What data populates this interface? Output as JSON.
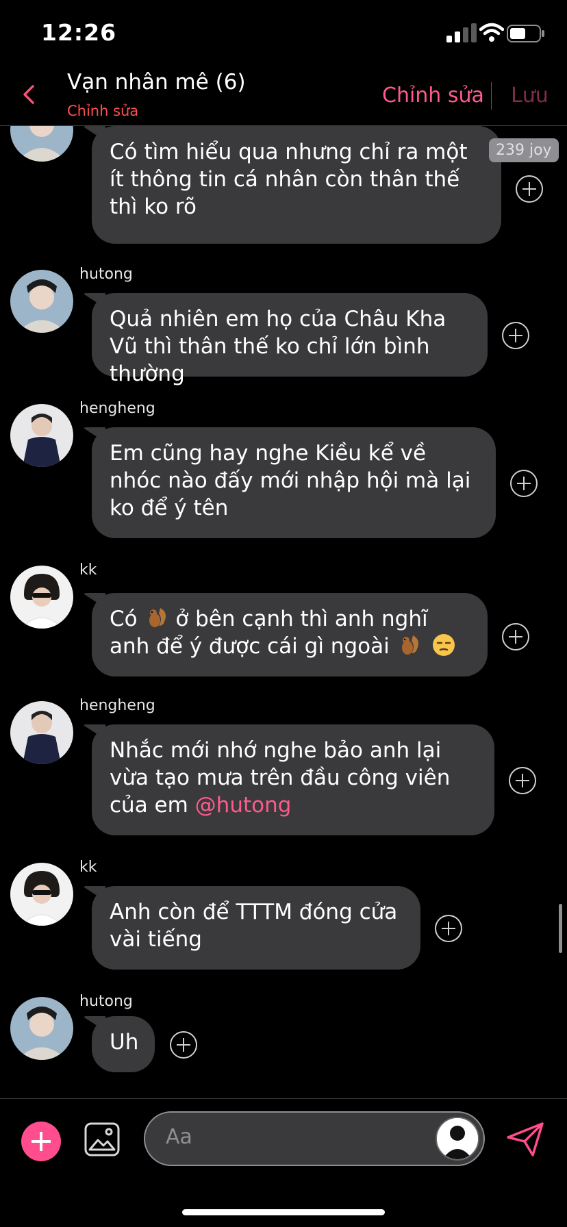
{
  "status_bar": {
    "time": "12:26"
  },
  "header": {
    "title": "Vạn nhân mê (6)",
    "subtitle": "Chỉnh sửa",
    "edit_label": "Chỉnh sửa",
    "save_label": "Lưu"
  },
  "joy_badge": "239 joy",
  "messages": [
    {
      "sender": "",
      "text": "Có tìm hiểu qua nhưng chỉ ra một ít thông tin cá nhân còn thân thế thì ko rõ"
    },
    {
      "sender": "hutong",
      "text": "Quả nhiên em họ của Châu Kha Vũ thì thân thế ko chỉ lớn bình thường"
    },
    {
      "sender": "hengheng",
      "text": "Em cũng hay nghe Kiều kể về nhóc nào đấy mới nhập hội mà lại ko để ý tên"
    },
    {
      "sender": "kk",
      "text_a": "Có",
      "text_b": "ở bên cạnh thì anh nghĩ anh để ý được cái gì ngoài"
    },
    {
      "sender": "hengheng",
      "text": "Nhắc mới nhớ nghe bảo anh lại vừa tạo mưa trên đầu công viên của em",
      "mention": "@hutong"
    },
    {
      "sender": "kk",
      "text": "Anh còn để TTTM đóng cửa vài tiếng"
    },
    {
      "sender": "hutong",
      "text": "Uh"
    }
  ],
  "composer": {
    "placeholder": "Aa"
  },
  "icons": {
    "back": "chevron-left-icon",
    "add": "plus-circle-icon",
    "image": "image-icon",
    "send": "paper-plane-icon",
    "reaction": "add-reaction-icon"
  },
  "colors": {
    "accent": "#ff5a8c",
    "bubble": "#3a3a3c",
    "background": "#000000"
  }
}
